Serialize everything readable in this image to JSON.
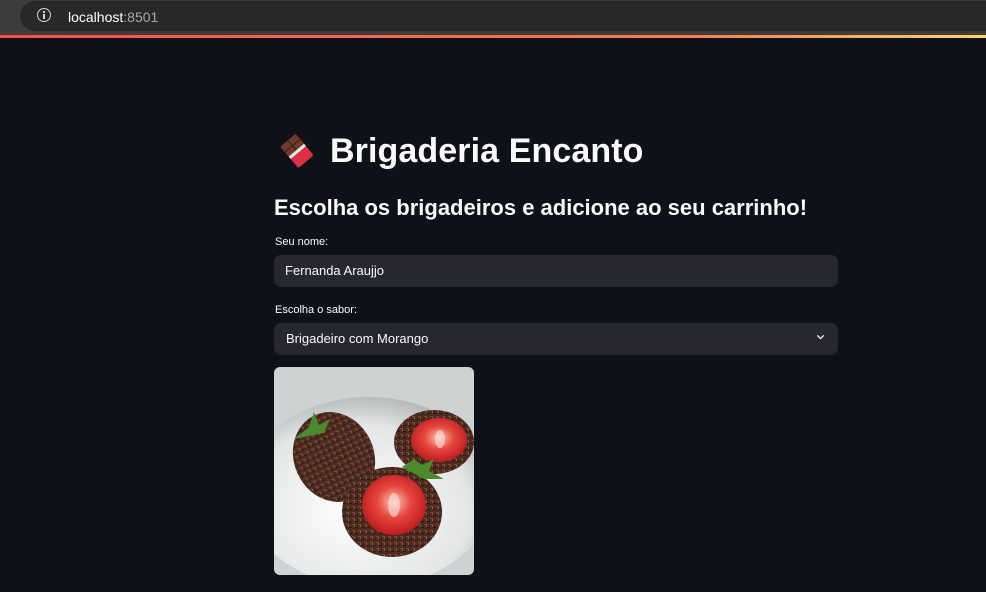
{
  "browser": {
    "url_host": "localhost",
    "url_port": ":8501"
  },
  "page": {
    "title": "Brigaderia Encanto",
    "title_icon": "chocolate-bar-icon",
    "subheader": "Escolha os brigadeiros e adicione ao seu carrinho!"
  },
  "form": {
    "name_label": "Seu nome:",
    "name_value": "Fernanda Araujjo",
    "flavor_label": "Escolha o sabor:",
    "flavor_selected": "Brigadeiro com Morango"
  },
  "colors": {
    "background": "#0e1117",
    "input_bg": "#262730",
    "text": "#fafafa",
    "accent": "#ff4b4b"
  }
}
